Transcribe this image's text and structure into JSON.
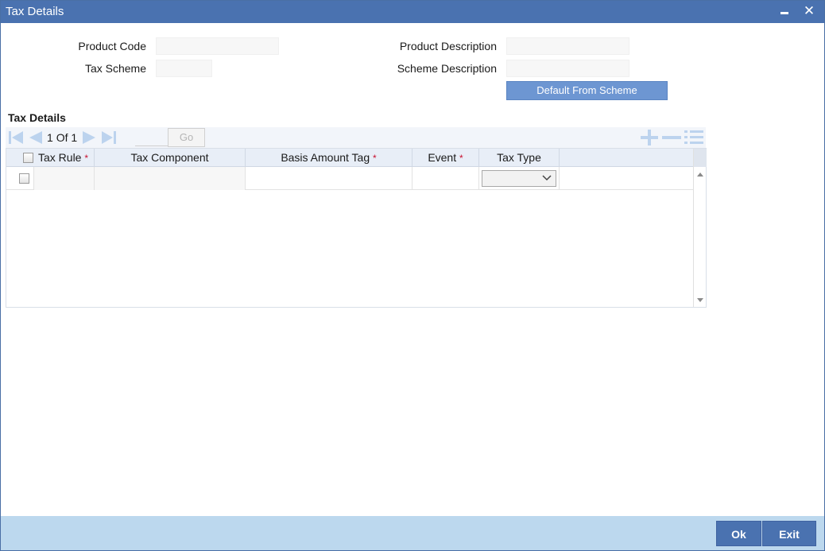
{
  "window": {
    "title": "Tax Details",
    "minimize_icon": "minimize-icon",
    "close_icon": "close-icon",
    "close_glyph": "✕"
  },
  "form": {
    "product_code_label": "Product Code",
    "product_code_value": "",
    "tax_scheme_label": "Tax Scheme",
    "tax_scheme_value": "",
    "product_description_label": "Product Description",
    "product_description_value": "",
    "scheme_description_label": "Scheme Description",
    "scheme_description_value": "",
    "default_button_label": "Default From Scheme"
  },
  "section": {
    "title": "Tax Details"
  },
  "pager": {
    "current": "1",
    "of_label": "Of",
    "total": "1",
    "goto_value": "",
    "go_label": "Go"
  },
  "grid": {
    "columns": [
      {
        "label": "Tax Rule",
        "required": true
      },
      {
        "label": "Tax Component",
        "required": false
      },
      {
        "label": "Basis Amount Tag",
        "required": true
      },
      {
        "label": "Event",
        "required": true
      },
      {
        "label": "Tax Type",
        "required": false
      }
    ],
    "required_mark": "*",
    "rows": [
      {
        "tax_rule": "",
        "tax_component": "",
        "basis_amount_tag": "",
        "event": "",
        "tax_type": ""
      }
    ]
  },
  "footer": {
    "ok_label": "Ok",
    "exit_label": "Exit"
  },
  "colors": {
    "titlebar": "#4a72b0",
    "accent_button": "#6d96d2",
    "footer": "#bcd8ee",
    "required": "#c8102e"
  }
}
